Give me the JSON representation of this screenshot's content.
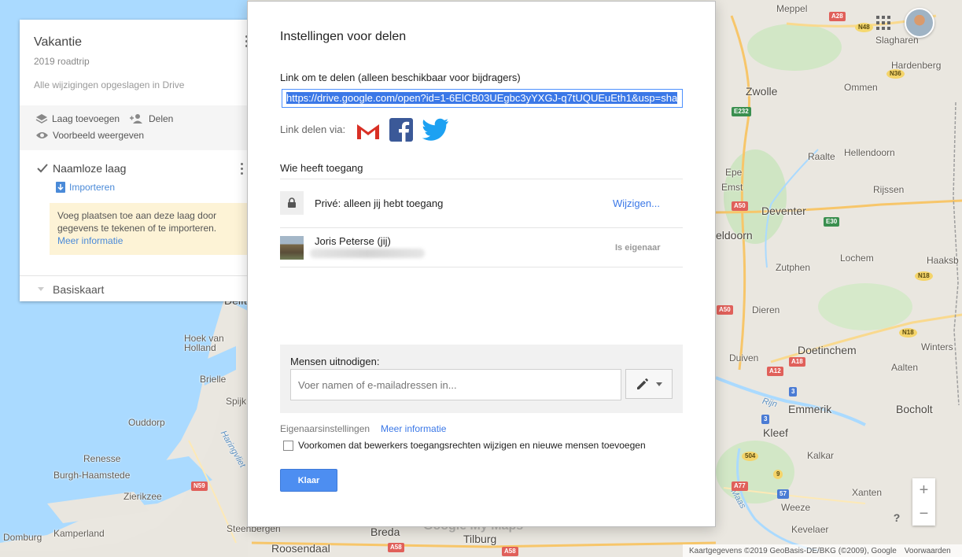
{
  "left_panel": {
    "map_title": "Vakantie",
    "map_description": "2019 roadtrip",
    "save_status": "Alle wijzigingen opgeslagen in Drive",
    "add_layer": "Laag toevoegen",
    "share": "Delen",
    "preview": "Voorbeeld weergeven",
    "layer_name": "Naamloze laag",
    "import": "Importeren",
    "hint_text": "Voeg plaatsen toe aan deze laag door gegevens te tekenen of te importeren.",
    "hint_link": "Meer informatie",
    "base_map": "Basiskaart"
  },
  "dialog": {
    "title": "Instellingen voor delen",
    "link_label": "Link om te delen (alleen beschikbaar voor bijdragers)",
    "link_value": "https://drive.google.com/open?id=1-6ElCB03UEgbc3yYXGJ-q7tUQUEuEth1&usp=sha",
    "share_via": "Link delen via:",
    "share_services": [
      "gmail-icon",
      "facebook-icon",
      "twitter-icon"
    ],
    "who_access": "Wie heeft toegang",
    "privacy": "Privé: alleen jij hebt toegang",
    "change": "Wijzigen...",
    "owner_name": "Joris Peterse (jij)",
    "owner_role": "Is eigenaar",
    "invite_label": "Mensen uitnodigen:",
    "invite_placeholder": "Voer namen of e-mailadressen in...",
    "owner_settings": "Eigenaarsinstellingen",
    "owner_more": "Meer informatie",
    "checkbox_label": "Voorkomen dat bewerkers toegangsrechten wijzigen en nieuwe mensen toevoegen",
    "checkbox_checked": false,
    "done": "Klaar"
  },
  "map": {
    "places": {
      "meppel": "Meppel",
      "slagharen": "Slagharen",
      "hardenberg": "Hardenberg",
      "zwolle": "Zwolle",
      "ommen": "Ommen",
      "hellendoorn": "Hellendoorn",
      "raalte": "Raalte",
      "epe": "Epe",
      "rijssen": "Rijssen",
      "emst": "Emst",
      "deventer": "Deventer",
      "apeldoorn": "eldoorn",
      "lochem": "Lochem",
      "haaksb": "Haaksb",
      "zutphen": "Zutphen",
      "dieren": "Dieren",
      "doetinchem": "Doetinchem",
      "duiven": "Duiven",
      "aalten": "Aalten",
      "winterswijk": "Winters",
      "emmerik": "Emmerik",
      "bocholt": "Bocholt",
      "kleef": "Kleef",
      "kalkar": "Kalkar",
      "xanten": "Xanten",
      "weeze": "Weeze",
      "kevelaer": "Kevelaer",
      "hoek_van_holland": "Hoek van\nHolland",
      "brielle": "Brielle",
      "spijk": "Spijk",
      "ouddorp": "Ouddorp",
      "renesse": "Renesse",
      "burgh_haamstede": "Burgh-Haamstede",
      "zierikzee": "Zierikzee",
      "domburg": "Domburg",
      "kamperland": "Kamperland",
      "steenbergen": "Steenbergen",
      "roosendaal": "Roosendaal",
      "breda": "Breda",
      "tilburg": "Tilburg",
      "delft": "Delft",
      "rijn": "Rijn",
      "maas": "Maas",
      "haringvliet": "Haringvliet"
    },
    "roads": {
      "a28": "A28",
      "n48": "N48",
      "n36": "N36",
      "e232": "E232",
      "a50": "A50",
      "e30": "E30",
      "n18a": "N18",
      "n18b": "N18",
      "a12": "A12",
      "a18": "A18",
      "e35": "3",
      "a3": "3",
      "n504": "504",
      "a77": "A77",
      "n57": "57",
      "n9": "9",
      "n59": "N59",
      "a58": "A58",
      "a58b": "A58",
      "a50b": "A50"
    },
    "watermark": "Google My Maps",
    "attribution": "Kaartgegevens ©2019 GeoBasis-DE/BKG (©2009), Google",
    "terms": "Voorwaarden",
    "zoom_in": "+",
    "zoom_out": "−",
    "help": "?"
  }
}
